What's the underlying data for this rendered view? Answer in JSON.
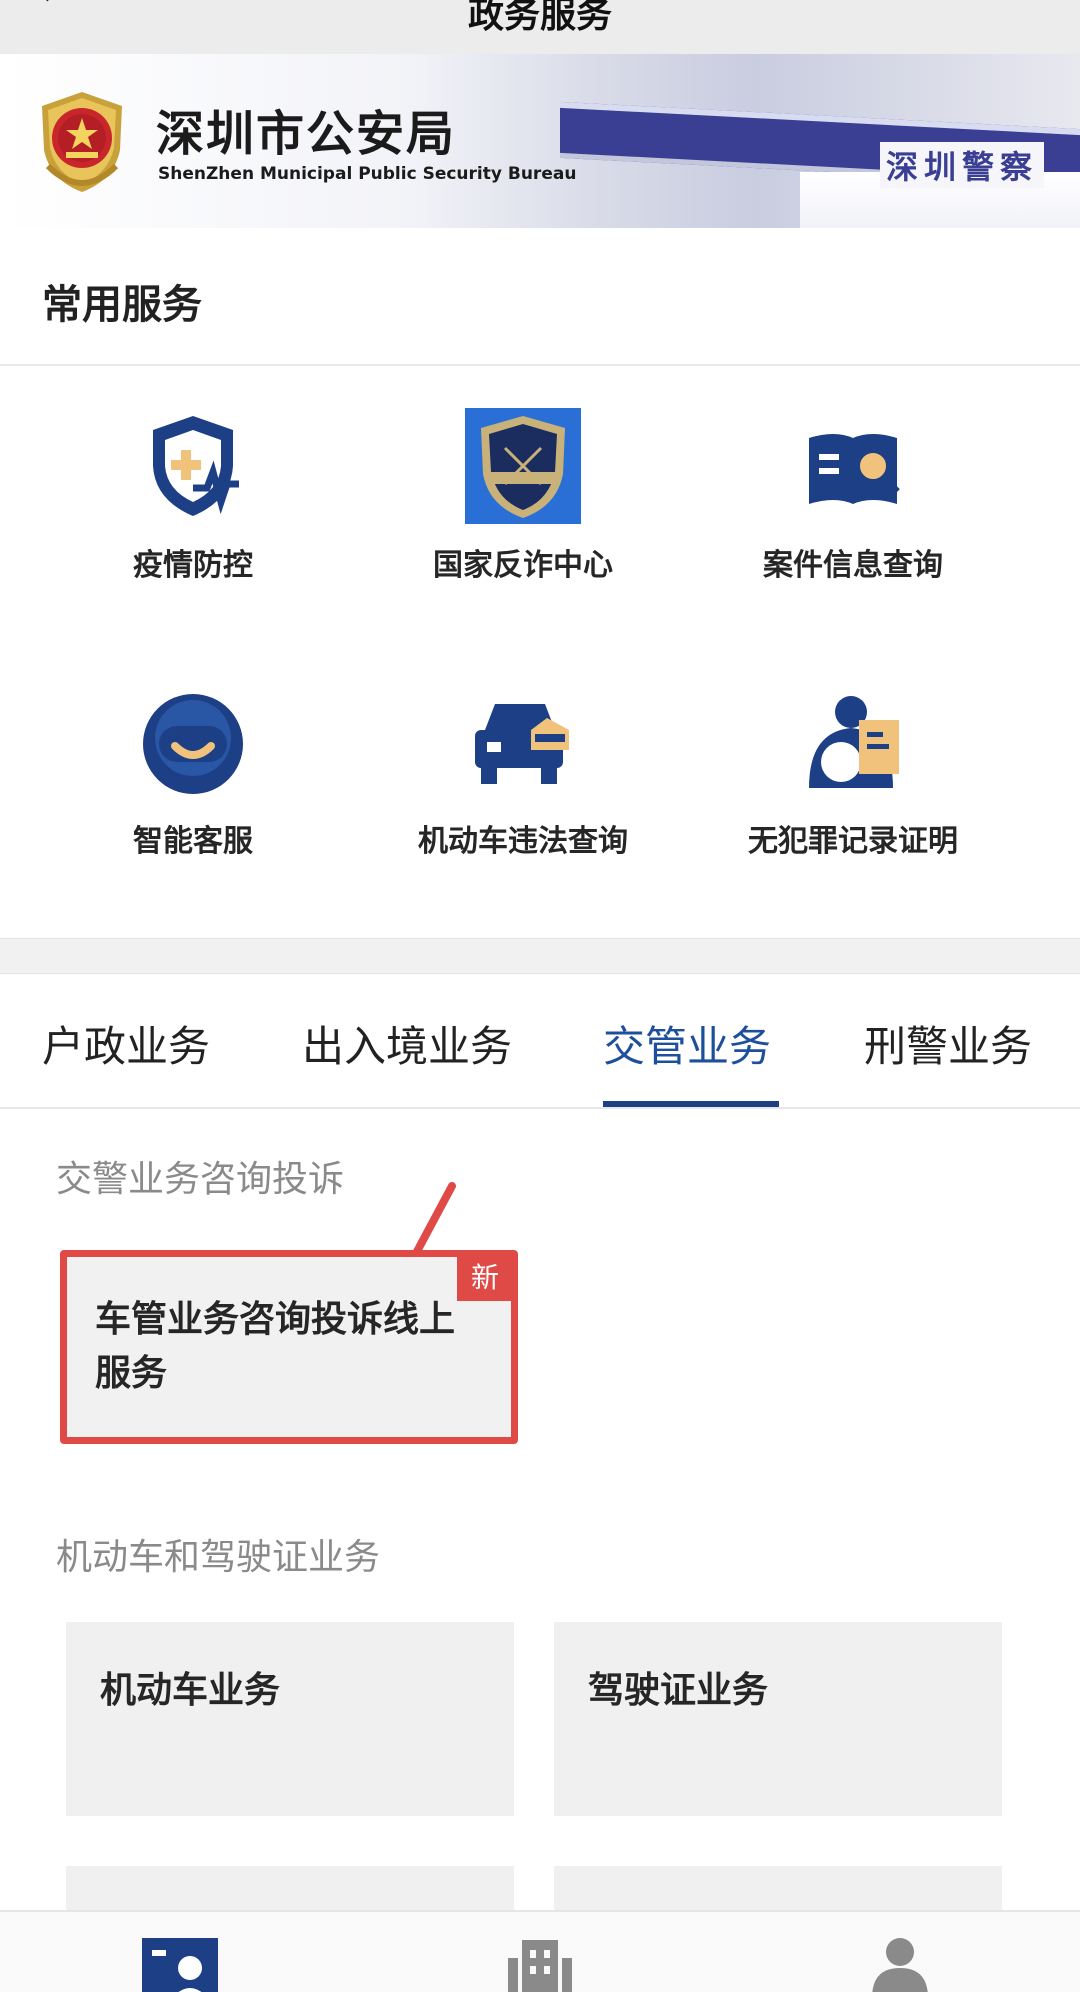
{
  "topbar": {
    "title": "政务服务"
  },
  "banner": {
    "org_name": "深圳市公安局",
    "org_en": "ShenZhen Municipal Public Security Bureau",
    "sign_left": "",
    "sign_right": "深圳警察"
  },
  "common_services": {
    "title": "常用服务",
    "items": [
      {
        "label": "疫情防控",
        "icon": "shield-plus-icon"
      },
      {
        "label": "国家反诈中心",
        "icon": "anti-fraud-badge-icon"
      },
      {
        "label": "案件信息查询",
        "icon": "book-search-icon"
      },
      {
        "label": "智能客服",
        "icon": "robot-service-icon"
      },
      {
        "label": "机动车违法查询",
        "icon": "car-police-icon"
      },
      {
        "label": "无犯罪记录证明",
        "icon": "certificate-person-icon"
      }
    ]
  },
  "tabs": [
    {
      "label": "户政业务",
      "active": false
    },
    {
      "label": "出入境业务",
      "active": false
    },
    {
      "label": "交管业务",
      "active": true
    },
    {
      "label": "刑警业务",
      "active": false
    }
  ],
  "sections": {
    "complaint": {
      "title": "交警业务咨询投诉",
      "card_label": "车管业务咨询投诉线上服务",
      "badge": "新"
    },
    "vehicle": {
      "title": "机动车和驾驶证业务",
      "cards": [
        "机动车业务",
        "驾驶证业务"
      ]
    }
  },
  "colors": {
    "brand_blue": "#1d3f86",
    "accent_gold": "#f0c27b",
    "highlight_red": "#e04a46"
  },
  "bottom_nav": [
    {
      "icon": "service-profile-icon",
      "active": true
    },
    {
      "icon": "building-icon",
      "active": false
    },
    {
      "icon": "person-icon",
      "active": false
    }
  ]
}
